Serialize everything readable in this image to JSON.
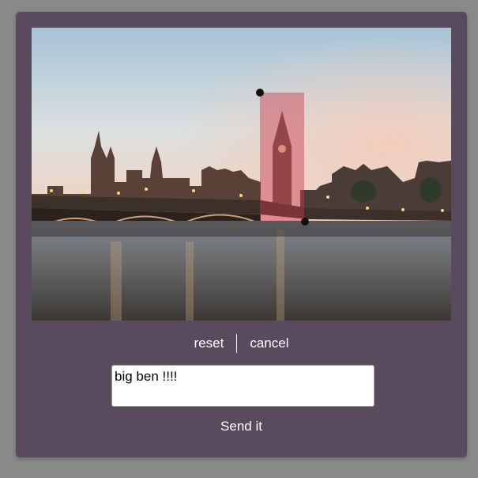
{
  "photo": {
    "alt": "London skyline at dusk with Westminster Bridge and Big Ben"
  },
  "actions": {
    "reset_label": "reset",
    "cancel_label": "cancel"
  },
  "caption": {
    "value": "big ben !!!!"
  },
  "send": {
    "label": "Send it"
  },
  "colors": {
    "dialog_bg": "#5a4a5e",
    "page_bg": "#8a8a8a",
    "selection": "#c83c50"
  }
}
